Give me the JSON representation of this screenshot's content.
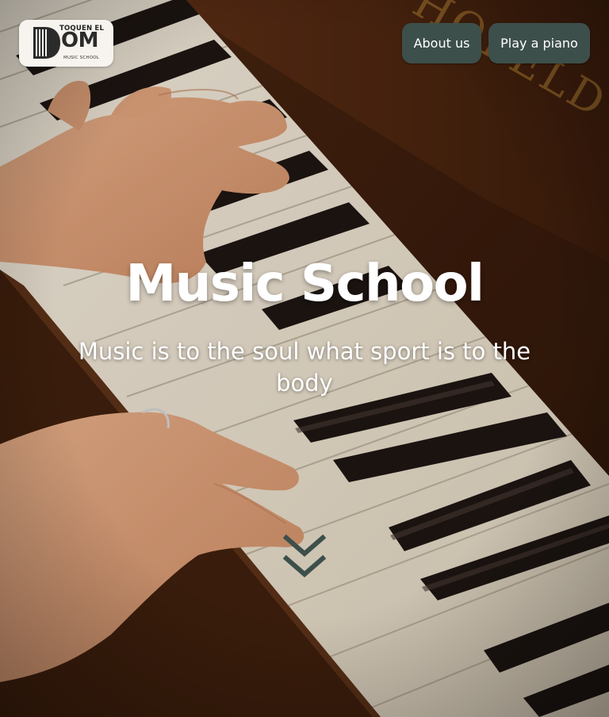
{
  "header": {
    "logo": {
      "top_text": "TOQUEN EL",
      "big_text": "OM",
      "small_text": "MUSIC SCHOOL",
      "icon": "piano-d-icon"
    },
    "nav": [
      {
        "label": "About us"
      },
      {
        "label": "Play a piano"
      }
    ]
  },
  "hero": {
    "title": "Music School",
    "subtitle": "Music is to the soul what sport is to the body",
    "scroll_icon": "double-chevron-down-icon",
    "background": "piano-keys-hands-photo"
  },
  "colors": {
    "nav_button_bg": "#3d4f4b",
    "nav_button_text": "#ffffff",
    "logo_bg": "#f7f3ee",
    "hero_text": "#ffffff",
    "scroll_icon": "#3d4f4b"
  }
}
